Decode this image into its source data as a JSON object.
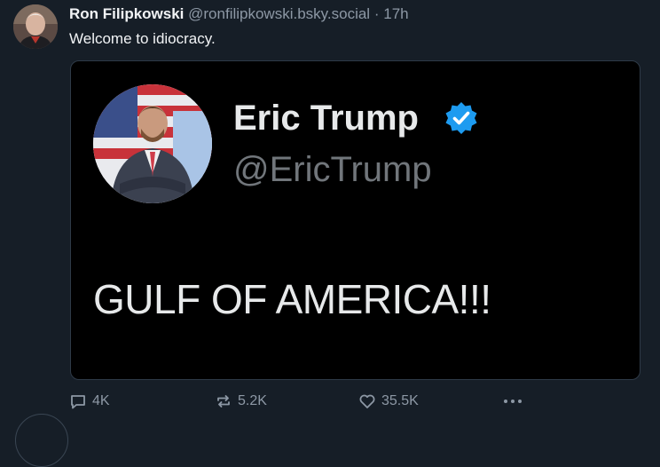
{
  "post": {
    "author_name": "Ron Filipkowski",
    "author_handle": "@ronfilipkowski.bsky.social",
    "separator": "·",
    "time": "17h",
    "text": "Welcome to idiocracy.",
    "embedded": {
      "name": "Eric Trump",
      "handle": "@EricTrump",
      "text": "GULF OF AMERICA!!!",
      "verified_color": "#1d9bf0"
    },
    "actions": {
      "replies": "4K",
      "reposts": "5.2K",
      "likes": "35.5K"
    }
  },
  "icons": [
    "reply-icon",
    "repost-icon",
    "like-icon",
    "more-icon",
    "verified-badge-icon"
  ],
  "colors": {
    "background": "#161e27",
    "embed_background": "#000000",
    "muted_text": "#8d98a5"
  }
}
